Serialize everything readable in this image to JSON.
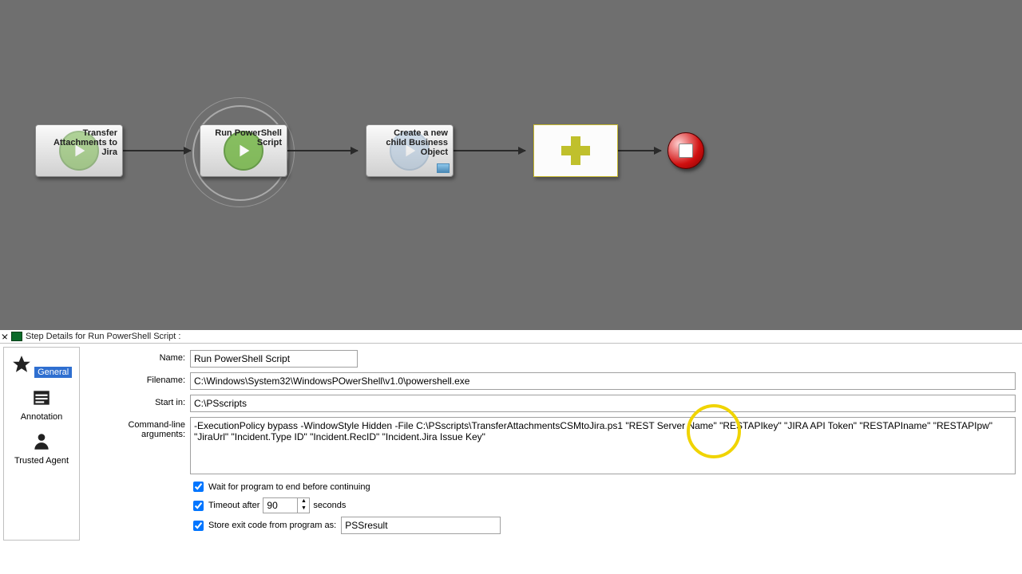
{
  "workflow": {
    "nodes": [
      {
        "id": "transfer",
        "label": "Transfer Attachments to Jira"
      },
      {
        "id": "run_ps",
        "label": "Run PowerShell Script"
      },
      {
        "id": "create_bo",
        "label": "Create a new child Business Object"
      }
    ]
  },
  "panel": {
    "header": "Step Details for Run PowerShell Script :",
    "side": {
      "general": "General",
      "annotation": "Annotation",
      "trusted_agent": "Trusted Agent"
    },
    "fields": {
      "name_label": "Name:",
      "name_value": "Run PowerShell Script",
      "filename_label": "Filename:",
      "filename_value": "C:\\Windows\\System32\\WindowsPOwerShell\\v1.0\\powershell.exe",
      "startin_label": "Start in:",
      "startin_value": "C:\\PSscripts",
      "args_label": "Command-line arguments:",
      "args_value": "-ExecutionPolicy bypass -WindowStyle Hidden -File C:\\PSscripts\\TransferAttachmentsCSMtoJira.ps1 \"REST Server Name\" \"RESTAPIkey\" \"JIRA API Token\" \"RESTAPIname\" \"RESTAPIpw\" \"JiraUrl\" \"Incident.Type ID\" \"Incident.RecID\" \"Incident.Jira Issue Key\"",
      "wait_label": "Wait for program to end before continuing",
      "timeout_label": "Timeout after",
      "timeout_value": "90",
      "timeout_suffix": "seconds",
      "store_label": "Store exit code from program as:",
      "store_value": "PSSresult"
    }
  },
  "chart_data": {
    "type": "diagram",
    "title": "One-Step Action workflow",
    "nodes": [
      {
        "id": "transfer",
        "kind": "action",
        "label": "Transfer Attachments to Jira"
      },
      {
        "id": "run_ps",
        "kind": "action",
        "label": "Run PowerShell Script",
        "selected": true
      },
      {
        "id": "create_bo",
        "kind": "action",
        "label": "Create a new child Business Object"
      },
      {
        "id": "add",
        "kind": "placeholder-add"
      },
      {
        "id": "end",
        "kind": "terminator-stop"
      }
    ],
    "edges": [
      [
        "transfer",
        "run_ps"
      ],
      [
        "run_ps",
        "create_bo"
      ],
      [
        "create_bo",
        "add"
      ],
      [
        "add",
        "end"
      ]
    ]
  }
}
